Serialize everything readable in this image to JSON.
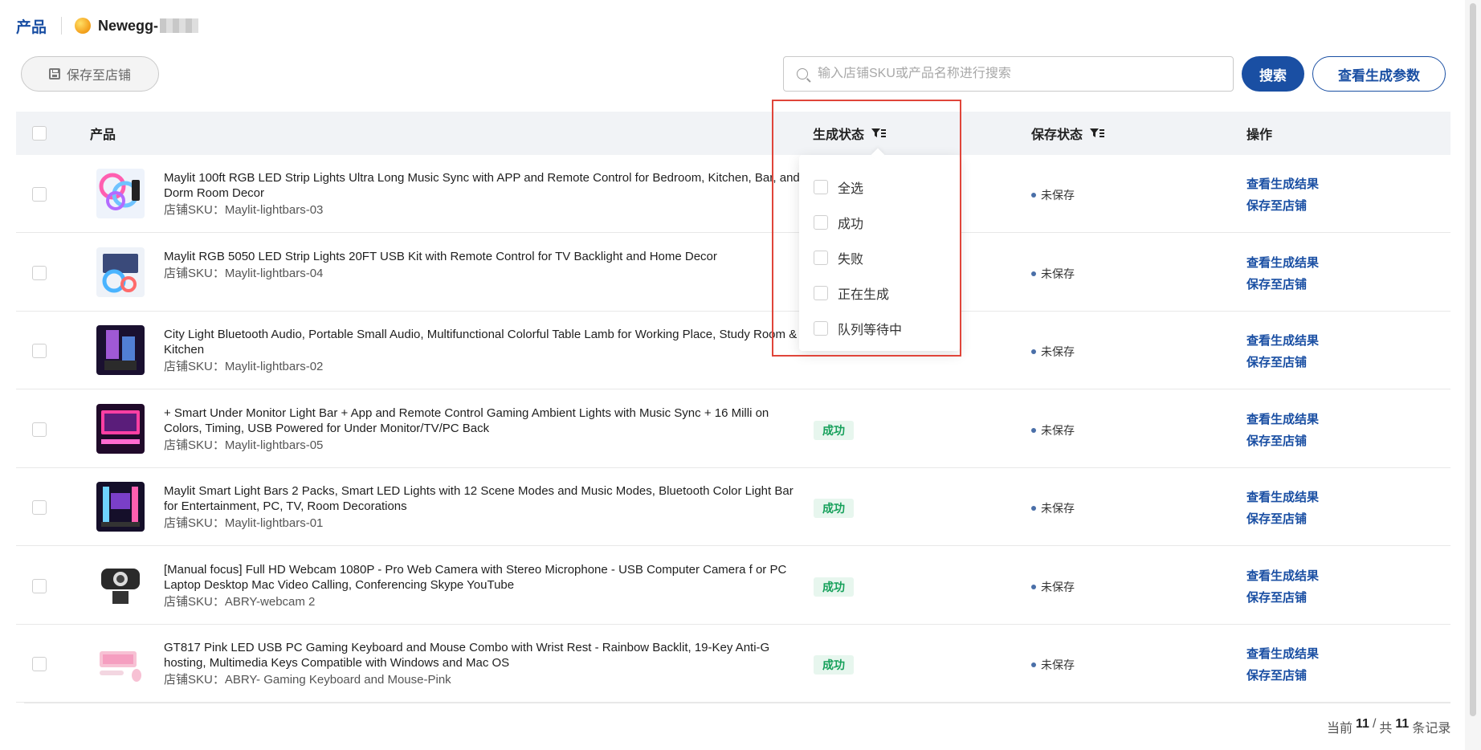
{
  "header": {
    "nav_title": "产品",
    "store_name": "Newegg-"
  },
  "toolbar": {
    "save_to_store_label": "保存至店铺",
    "search_placeholder": "输入店铺SKU或产品名称进行搜索",
    "search_button": "搜索",
    "view_params_button": "查看生成参数"
  },
  "table": {
    "columns": {
      "product": "产品",
      "gen_status": "生成状态",
      "save_status": "保存状态",
      "actions": "操作"
    },
    "rows": [
      {
        "title": "Maylit 100ft RGB LED Strip Lights Ultra Long Music Sync with APP and Remote Control for Bedroom, Kitchen, Bar, and Dorm Room Decor",
        "sku_label": "店铺SKU：",
        "sku": "Maylit-lightbars-03",
        "gen_status": "",
        "save_status": "未保存",
        "action_view": "查看生成结果",
        "action_save": "保存至店铺"
      },
      {
        "title": "Maylit RGB 5050 LED Strip Lights 20FT USB Kit with Remote Control for TV Backlight and Home Decor",
        "sku_label": "店铺SKU：",
        "sku": "Maylit-lightbars-04",
        "gen_status": "",
        "save_status": "未保存",
        "action_view": "查看生成结果",
        "action_save": "保存至店铺"
      },
      {
        "title": "City Light Bluetooth Audio, Portable Small Audio, Multifunctional Colorful Table Lamb for Working Place, Study Room & Kitchen",
        "sku_label": "店铺SKU：",
        "sku": "Maylit-lightbars-02",
        "gen_status": "",
        "save_status": "未保存",
        "action_view": "查看生成结果",
        "action_save": "保存至店铺"
      },
      {
        "title": "+ Smart Under Monitor Light Bar + App and Remote Control Gaming Ambient Lights with Music Sync + 16 Milli on Colors, Timing, USB Powered for Under Monitor/TV/PC Back",
        "sku_label": "店铺SKU：",
        "sku": "Maylit-lightbars-05",
        "gen_status": "成功",
        "save_status": "未保存",
        "action_view": "查看生成结果",
        "action_save": "保存至店铺"
      },
      {
        "title": "Maylit Smart Light Bars 2 Packs, Smart LED Lights with 12 Scene Modes and Music Modes, Bluetooth Color Light Bar for Entertainment, PC, TV, Room Decorations",
        "sku_label": "店铺SKU：",
        "sku": "Maylit-lightbars-01",
        "gen_status": "成功",
        "save_status": "未保存",
        "action_view": "查看生成结果",
        "action_save": "保存至店铺"
      },
      {
        "title": "[Manual focus] Full HD Webcam 1080P - Pro Web Camera with Stereo Microphone - USB Computer Camera f or PC Laptop Desktop Mac Video Calling, Conferencing Skype YouTube",
        "sku_label": "店铺SKU：",
        "sku": "ABRY-webcam 2",
        "gen_status": "成功",
        "save_status": "未保存",
        "action_view": "查看生成结果",
        "action_save": "保存至店铺"
      },
      {
        "title": "GT817 Pink LED USB PC Gaming Keyboard and Mouse Combo with Wrist Rest - Rainbow Backlit, 19-Key Anti-G hosting, Multimedia Keys Compatible with Windows and Mac OS",
        "sku_label": "店铺SKU：",
        "sku": "ABRY- Gaming Keyboard and Mouse-Pink",
        "gen_status": "成功",
        "save_status": "未保存",
        "action_view": "查看生成结果",
        "action_save": "保存至店铺"
      }
    ]
  },
  "filter_dropdown": {
    "options": [
      "全选",
      "成功",
      "失败",
      "正在生成",
      "队列等待中"
    ]
  },
  "pagination": {
    "current_label": "当前",
    "current": "11",
    "sep": "/",
    "total_label": "共",
    "total": "11",
    "records_label": "条记录"
  },
  "colors": {
    "brand": "#1a4fa3",
    "success_text": "#15a05a",
    "success_bg": "#e7f6ee",
    "highlight": "#e0453a"
  }
}
